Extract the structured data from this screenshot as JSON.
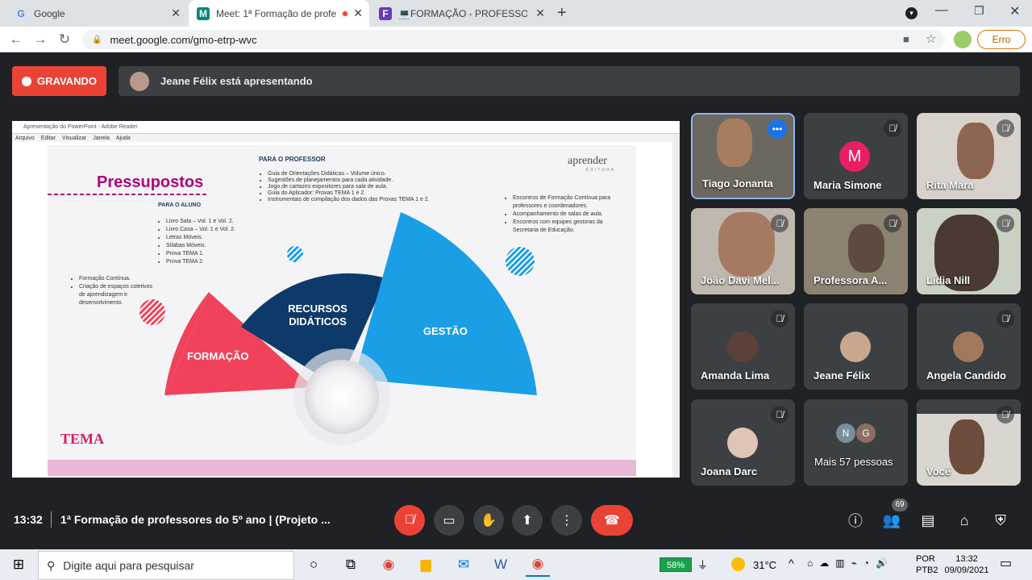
{
  "tabs": [
    {
      "title": "Google",
      "favicon": "G"
    },
    {
      "title": "Meet: 1ª Formação de profe",
      "favicon": "M"
    },
    {
      "title": "💻FORMAÇÃO - PROFESSORES",
      "favicon": "F"
    }
  ],
  "address": {
    "url": "meet.google.com/gmo-etrp-wvc",
    "profile_status": "Erro"
  },
  "meet": {
    "recording_label": "GRAVANDO",
    "presenting_text": "Jeane Félix está apresentando",
    "time": "13:32",
    "meeting_title": "1ª Formação de professores do 5º ano | (Projeto ...",
    "participant_count": "69"
  },
  "adobe": {
    "title": "Apresentação do PowerPoint - Adobe Reader",
    "menu": [
      "Arquivo",
      "Editar",
      "Visualizar",
      "Janela",
      "Ajuda"
    ]
  },
  "slide": {
    "title": "Pressupostos",
    "logo": "aprender",
    "logo_sub": "EDITORA",
    "tema_logo": "TEMA",
    "professor_heading": "PARA O PROFESSOR",
    "professor_items": [
      "Guia de Orientações Didáticas – Volume único.",
      "Sugestões de planejamentos para cada atividade.",
      "Jogo de cartazes expositores para sala de aula.",
      "Guia do Aplicador: Provas TEMA 1 e 2.",
      "Instrumentais de compilação dos dados das Provas TEMA 1 e 2."
    ],
    "aluno_heading": "PARA O ALUNO",
    "aluno_items": [
      "Livro Sala – Vol. 1 e Vol. 2.",
      "Livro Casa – Vol. 1 e Vol. 2.",
      "Letras Móveis.",
      "Sílabas Móveis.",
      "Prova TEMA 1.",
      "Prova TEMA 2."
    ],
    "formacao_items": [
      "Formação Contínua.",
      "Criação de espaços coletivos de aprendizagem e desenvolvimento."
    ],
    "gestao_items": [
      "Encontros de Formação Contínua para professores e coordenadores.",
      "Acompanhamento de salas de aula.",
      "Encontros com equipes gestoras da Secretaria de Educação."
    ],
    "label_formacao": "FORMAÇÃO",
    "label_recursos_1": "RECURSOS",
    "label_recursos_2": "DIDÁTICOS",
    "label_gestao": "GESTÃO",
    "colors": {
      "formacao": "#f0435b",
      "recursos": "#0d3a6a",
      "gestao": "#1a9ee6",
      "accent": "#b0007c"
    }
  },
  "participants": [
    {
      "name": "Tiago Jonanta"
    },
    {
      "name": "Maria Simone",
      "initial": "M"
    },
    {
      "name": "Rita Mara"
    },
    {
      "name": "João Davi Mel..."
    },
    {
      "name": "Professora A..."
    },
    {
      "name": "Lídia Nill"
    },
    {
      "name": "Amanda Lima"
    },
    {
      "name": "Jeane Félix"
    },
    {
      "name": "Angela Candido"
    },
    {
      "name": "Joana Darc"
    },
    {
      "name": "Mais 57 pessoas",
      "initials": [
        "N",
        "G"
      ]
    },
    {
      "name": "Você"
    }
  ],
  "taskbar": {
    "search_placeholder": "Digite aqui para pesquisar",
    "battery": "58%",
    "temperature": "31°C",
    "lang_1": "POR",
    "lang_2": "PTB2",
    "clock_time": "13:32",
    "clock_date": "09/09/2021"
  }
}
